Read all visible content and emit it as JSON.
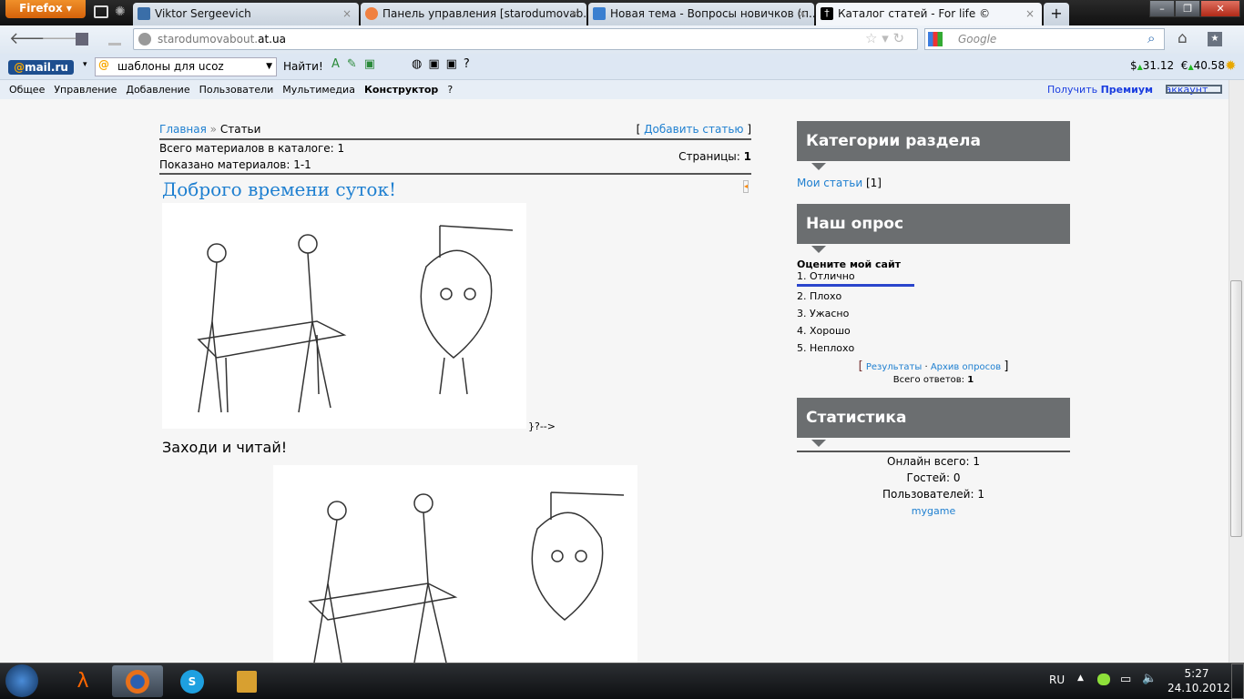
{
  "browser": {
    "menu_button": "Firefox",
    "tabs": [
      {
        "title": "Viktor Sergeevich"
      },
      {
        "title": "Панель управления [starodumovab..."
      },
      {
        "title": "Новая тема - Вопросы новичков (п..."
      },
      {
        "title": "Каталог статей - For life ©"
      }
    ],
    "new_tab": "+",
    "url_prefix": "starodumovabout.",
    "url_domain": "at.ua",
    "search_placeholder": "Google"
  },
  "mail_toolbar": {
    "logo_prefix": "@",
    "logo": "mail.ru",
    "search_value": "шаблоны для ucoz",
    "find_button": "Найти!",
    "usd": "31.12",
    "eur": "40.58",
    "usd_symbol": "$",
    "eur_symbol": "€"
  },
  "ucoz_menu": {
    "items": [
      "Общее",
      "Управление",
      "Добавление",
      "Пользователи",
      "Мультимедиа",
      "Конструктор",
      "?"
    ],
    "premium_pre": "Получить",
    "premium_bold": "Премиум",
    "premium_post": "аккаунт"
  },
  "main": {
    "breadcrumb_home": "Главная",
    "breadcrumb_sep": "»",
    "breadcrumb_current": "Статьи",
    "add_article": "Добавить статью",
    "total_label": "Всего материалов в каталоге:",
    "total": "1",
    "shown_label": "Показано материалов:",
    "shown": "1-1",
    "pages_label": "Страницы:",
    "pages": "1",
    "article_title": "Доброго времени суток!",
    "stray_text": "}?-->",
    "subtitle": "Заходи и читай!"
  },
  "sidebar": {
    "categories": {
      "title": "Категории раздела",
      "items": [
        {
          "label": "Мои статьи",
          "count": "[1]"
        }
      ]
    },
    "poll": {
      "title": "Наш опрос",
      "question": "Оцените мой сайт",
      "options": [
        "1. Отлично",
        "2. Плохо",
        "3. Ужасно",
        "4. Хорошо",
        "5. Неплохо"
      ],
      "results": "Результаты",
      "archive": "Архив опросов",
      "total_label": "Всего ответов:",
      "total": "1",
      "bar_fraction": 1.0
    },
    "stats": {
      "title": "Статистика",
      "online_label": "Онлайн всего:",
      "online": "1",
      "guests_label": "Гостей:",
      "guests": "0",
      "users_label": "Пользователей:",
      "users": "1",
      "user": "mygame"
    }
  },
  "taskbar": {
    "lang": "RU",
    "time": "5:27",
    "date": "24.10.2012"
  }
}
